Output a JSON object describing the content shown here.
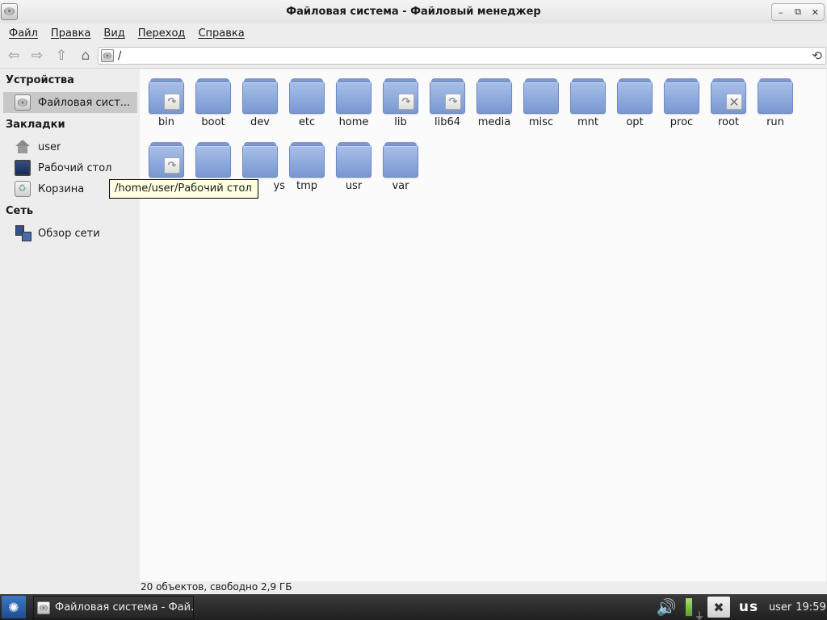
{
  "window": {
    "title": "Файловая система - Файловый менеджер",
    "controls": {
      "minimize": "–",
      "maximize": "⧉",
      "close": "✕"
    }
  },
  "menubar": {
    "items": [
      "Файл",
      "Правка",
      "Вид",
      "Переход",
      "Справка"
    ]
  },
  "toolbar": {
    "back_icon": "⇦",
    "forward_icon": "⇨",
    "up_icon": "⇧",
    "home_icon": "⌂",
    "location": "/",
    "reload_icon": "⟲"
  },
  "sidebar": {
    "devices_header": "Устройства",
    "devices": [
      {
        "label": "Файловая сист...",
        "icon": "disk-icon"
      }
    ],
    "bookmarks_header": "Закладки",
    "bookmarks": [
      {
        "label": "user",
        "icon": "home-icon"
      },
      {
        "label": "Рабочий стол",
        "icon": "desktop-icon"
      },
      {
        "label": "Корзина",
        "icon": "trash-icon"
      }
    ],
    "network_header": "Сеть",
    "network": [
      {
        "label": "Обзор сети",
        "icon": "network-icon"
      }
    ]
  },
  "files": [
    {
      "name": "bin",
      "emblem": "symlink"
    },
    {
      "name": "boot",
      "emblem": ""
    },
    {
      "name": "dev",
      "emblem": ""
    },
    {
      "name": "etc",
      "emblem": ""
    },
    {
      "name": "home",
      "emblem": ""
    },
    {
      "name": "lib",
      "emblem": "symlink"
    },
    {
      "name": "lib64",
      "emblem": "symlink"
    },
    {
      "name": "media",
      "emblem": ""
    },
    {
      "name": "misc",
      "emblem": ""
    },
    {
      "name": "mnt",
      "emblem": ""
    },
    {
      "name": "opt",
      "emblem": ""
    },
    {
      "name": "proc",
      "emblem": ""
    },
    {
      "name": "root",
      "emblem": "no-access"
    },
    {
      "name": "run",
      "emblem": ""
    },
    {
      "name": "",
      "emblem": "symlink"
    },
    {
      "name": "",
      "emblem": ""
    },
    {
      "name": "ys",
      "emblem": ""
    },
    {
      "name": "tmp",
      "emblem": ""
    },
    {
      "name": "usr",
      "emblem": ""
    },
    {
      "name": "var",
      "emblem": ""
    }
  ],
  "tooltip": "/home/user/Рабочий стол",
  "statusbar": {
    "text": "20 объектов, свободно 2,9 ГБ"
  },
  "taskbar": {
    "start_icon": "✺",
    "task_label": "Файловая система - Фай...",
    "volume_icon": "🔊",
    "plug_icon": "⏚",
    "network_icon": "✖",
    "keyboard_layout": "us",
    "user": "user",
    "clock": "19:59"
  },
  "colors": {
    "folder": "#8aa6dc",
    "selection": "#c8c8c8",
    "tooltip_bg": "#ffffe1",
    "taskbar": "#2a2a2a"
  }
}
